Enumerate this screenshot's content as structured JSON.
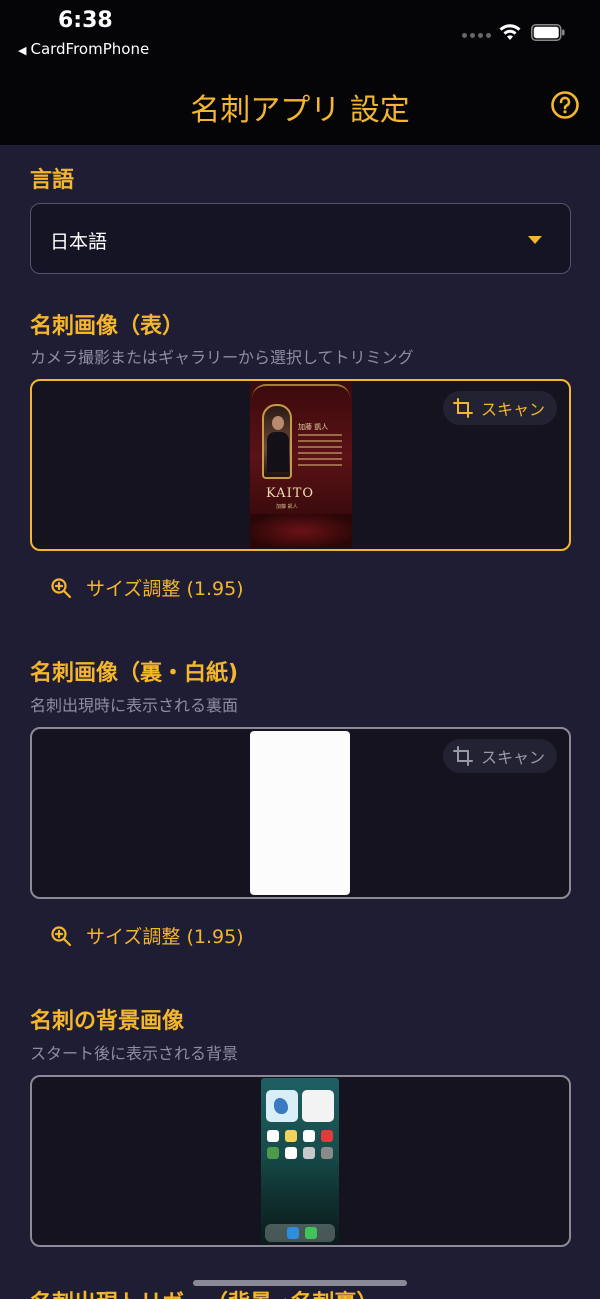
{
  "status_bar": {
    "time": "6:38",
    "back_app": "CardFromPhone",
    "back_glyph": "◀"
  },
  "nav": {
    "title": "名刺アプリ 設定",
    "help_icon": "question-circle-icon"
  },
  "language": {
    "title": "言語",
    "value": "日本語"
  },
  "card_front": {
    "title": "名刺画像（表）",
    "subtitle": "カメラ撮影またはギャラリーから選択してトリミング",
    "scan_label": "スキャン",
    "size_label": "サイズ調整 (1.95)",
    "card_name": "加藤 凱人",
    "card_brand": "KAITO",
    "card_tagline": "加藤 凱人"
  },
  "card_back": {
    "title": "名刺画像（裏・白紙)",
    "subtitle": "名刺出現時に表示される裏面",
    "scan_label": "スキャン",
    "size_label": "サイズ調整 (1.95)"
  },
  "background": {
    "title": "名刺の背景画像",
    "subtitle": "スタート後に表示される背景"
  },
  "next_section": {
    "title": "名刺出現トリガー（背景→名刺裏）"
  },
  "colors": {
    "accent": "#f4b62c",
    "background": "#1f1d33",
    "header": "#050508",
    "muted": "#8e8ca3"
  }
}
